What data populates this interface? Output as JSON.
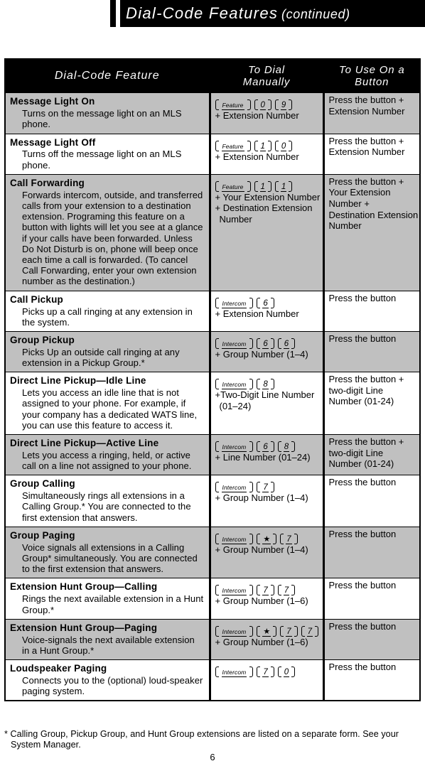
{
  "header": {
    "title_main": "Dial-Code Features",
    "title_sub": "(continued)"
  },
  "table": {
    "columns": {
      "feature": "Dial-Code Feature",
      "dial_line1": "To Dial",
      "dial_line2": "Manually",
      "button_line1": "To Use On a",
      "button_line2": "Button"
    },
    "rows": [
      {
        "title": "Message Light On",
        "desc": "Turns on the message light on an MLS phone.",
        "keys": [
          {
            "type": "word",
            "label": "Feature"
          },
          {
            "type": "digit",
            "label": "0"
          },
          {
            "type": "digit",
            "label": "9"
          }
        ],
        "dial_notes": [
          "+ Extension Number"
        ],
        "button": [
          "Press the button +",
          "Extension Number"
        ],
        "shaded": true
      },
      {
        "title": "Message Light Off",
        "desc": "Turns off the message light on an MLS phone.",
        "keys": [
          {
            "type": "word",
            "label": "Feature"
          },
          {
            "type": "digit",
            "label": "1"
          },
          {
            "type": "digit",
            "label": "0"
          }
        ],
        "dial_notes": [
          "+  Extension  Number"
        ],
        "button": [
          "Press the button +",
          "Extension Number"
        ],
        "shaded": false
      },
      {
        "title": "Call Forwarding",
        "desc": "Forwards intercom, outside, and transferred calls from your extension to a destination extension. Programing this feature on a button with lights will let you see at a glance if your calls have been forwarded. Unless Do Not Disturb is on, phone will beep once each time a call is forwarded. (To cancel Call Forwarding, enter your own extension number as the destination.)",
        "keys": [
          {
            "type": "word",
            "label": "Feature"
          },
          {
            "type": "digit",
            "label": "1"
          },
          {
            "type": "digit",
            "label": "1"
          }
        ],
        "dial_notes": [
          "+ Your  Extension  Number",
          "+ Destination  Extension",
          "Number"
        ],
        "button": [
          "Press the button +",
          "Your  Extension",
          "Number +",
          "Destination   Extension",
          "Number"
        ],
        "shaded": true
      },
      {
        "title": "Call Pickup",
        "desc": "Picks up a call ringing at any extension in the system.",
        "keys": [
          {
            "type": "word",
            "label": "Intercom"
          },
          {
            "type": "digit",
            "label": "6"
          }
        ],
        "dial_notes": [
          "+ Extension Number"
        ],
        "button": [
          "Press  the  button"
        ],
        "shaded": false
      },
      {
        "title": "Group  Pickup",
        "desc": "Picks Up an outside call ringing at any extension in a Pickup Group.*",
        "keys": [
          {
            "type": "word",
            "label": "Intercom"
          },
          {
            "type": "digit",
            "label": "6"
          },
          {
            "type": "digit",
            "label": "6"
          }
        ],
        "dial_notes": [
          "+ Group Number (1–4)"
        ],
        "button": [
          "Press  the  button"
        ],
        "shaded": true
      },
      {
        "title": "Direct  Line  Pickup—Idle  Line",
        "desc": "Lets you access an idle line that is not assigned to your phone. For example, if your company has a dedicated WATS line, you can use this feature to access it.",
        "keys": [
          {
            "type": "word",
            "label": "Intercom"
          },
          {
            "type": "digit",
            "label": "8"
          }
        ],
        "dial_notes": [
          "+Two-Digit Line Number",
          "(01–24)"
        ],
        "button": [
          "Press the button +",
          "two-digit  Line",
          "Number  (01-24)"
        ],
        "shaded": false
      },
      {
        "title": "Direct  Line  Pickup—Active  Line",
        "desc": "Lets you access a ringing, held, or active call on a line not assigned to your phone.",
        "keys": [
          {
            "type": "word",
            "label": "Intercom"
          },
          {
            "type": "digit",
            "label": "6"
          },
          {
            "type": "digit",
            "label": "8"
          }
        ],
        "dial_notes": [
          "+ Line Number (01–24)"
        ],
        "button": [
          "Press the button +",
          "two-digit  Line",
          "Number (01-24)"
        ],
        "shaded": true
      },
      {
        "title": "Group   Calling",
        "desc": "Simultaneously rings all extensions in a Calling Group.* You are connected to the first extension that answers.",
        "keys": [
          {
            "type": "word",
            "label": "Intercom"
          },
          {
            "type": "digit",
            "label": "7"
          }
        ],
        "dial_notes": [
          "+ Group Number (1–4)"
        ],
        "button": [
          "Press the button"
        ],
        "shaded": false
      },
      {
        "title": "Group Paging",
        "desc": "Voice signals all extensions in a Calling Group* simultaneously. You are connected to the first extension that answers.",
        "keys": [
          {
            "type": "word",
            "label": "Intercom"
          },
          {
            "type": "star",
            "label": "★"
          },
          {
            "type": "digit",
            "label": "7"
          }
        ],
        "dial_notes": [
          "+ Group Number (1–4)"
        ],
        "button": [
          "Press the button"
        ],
        "shaded": true
      },
      {
        "title": "Extension   Hunt   Group—Calling",
        "desc": "Rings the next available extension in a Hunt Group.*",
        "keys": [
          {
            "type": "word",
            "label": "Intercom"
          },
          {
            "type": "digit",
            "label": "7"
          },
          {
            "type": "digit",
            "label": "7"
          }
        ],
        "dial_notes": [
          "+ Group Number (1–6)"
        ],
        "button": [
          "Press  the  button"
        ],
        "shaded": false
      },
      {
        "title": "Extension  Hunt  Group—Paging",
        "desc": "Voice-signals the next available extension in a Hunt Group.*",
        "keys": [
          {
            "type": "word",
            "label": "Intercom"
          },
          {
            "type": "star",
            "label": "★"
          },
          {
            "type": "digit",
            "label": "7"
          },
          {
            "type": "digit",
            "label": "7"
          }
        ],
        "dial_notes": [
          "+ Group Number (1–6)"
        ],
        "button": [
          "Press  the  button"
        ],
        "shaded": true
      },
      {
        "title": "Loudspeaker   Paging",
        "desc": "Connects you to the (optional) loud-speaker paging system.",
        "keys": [
          {
            "type": "word",
            "label": "Intercom"
          },
          {
            "type": "digit",
            "label": "7"
          },
          {
            "type": "digit",
            "label": "0"
          }
        ],
        "dial_notes": [],
        "button": [
          "Press  the  button"
        ],
        "shaded": false
      }
    ]
  },
  "footnote": {
    "line1": "* Calling Group, Pickup Group, and Hunt Group extensions are listed on a separate form. See your",
    "line2": "System  Manager."
  },
  "folio": "6"
}
